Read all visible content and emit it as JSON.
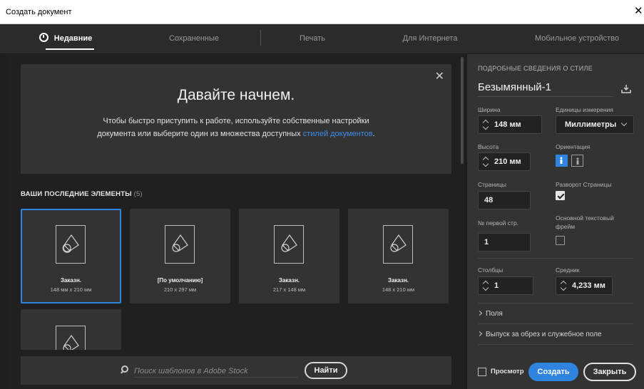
{
  "window": {
    "title": "Создать документ",
    "close_glyph": "✕"
  },
  "tabs": [
    {
      "label": "Недавние",
      "active": true
    },
    {
      "label": "Сохраненные",
      "active": false
    },
    {
      "label": "Печать",
      "active": false
    },
    {
      "label": "Для Интернета",
      "active": false
    },
    {
      "label": "Мобильное устройство",
      "active": false
    }
  ],
  "welcome": {
    "close_glyph": "✕",
    "heading": "Давайте начнем.",
    "text": "Чтобы быстро приступить к работе, используйте собственные настройки документа или выберите один из множества доступных ",
    "link": "стилей документов",
    "text_end": "."
  },
  "recent": {
    "title": "ВАШИ ПОСЛЕДНИЕ ЭЛЕМЕНТЫ",
    "count": "(5)",
    "items": [
      {
        "name": "Заказн.",
        "size": "148 мм x 210 мм",
        "selected": true
      },
      {
        "name": "[По умолчанию]",
        "size": "210 x 297 мм",
        "selected": false
      },
      {
        "name": "Заказн.",
        "size": "217 x 148 мм",
        "selected": false
      },
      {
        "name": "Заказн.",
        "size": "148 x 210 мм",
        "selected": false
      },
      {
        "name": "",
        "size": "",
        "selected": false
      }
    ]
  },
  "search": {
    "placeholder": "Поиск шаблонов в Adobe Stock",
    "button": "Найти"
  },
  "panel": {
    "title": "ПОДРОБНЫЕ СВЕДЕНИЯ О СТИЛЕ",
    "doc_name": "Безымянный-1",
    "width_label": "Ширина",
    "width_value": "148 мм",
    "units_label": "Единицы измерения",
    "units_value": "Миллиметры",
    "height_label": "Высота",
    "height_value": "210 мм",
    "orientation_label": "Ориентация",
    "pages_label": "Страницы",
    "pages_value": "48",
    "spread_label": "Разворот Страницы",
    "spread_checked": true,
    "first_page_label": "№ первой стр.",
    "first_page_value": "1",
    "text_frame_label": "Основной текстовый фрейм",
    "text_frame_checked": false,
    "columns_label": "Столбцы",
    "columns_value": "1",
    "gutter_label": "Средник",
    "gutter_value": "4,233 мм",
    "margins_label": "Поля",
    "bleed_label": "Выпуск за обрез и служебное поле"
  },
  "footer": {
    "preview_label": "Просмотр",
    "create": "Создать",
    "close": "Закрыть"
  },
  "colors": {
    "accent": "#2f84e0",
    "panel": "#333333",
    "background": "#1e1e1e"
  }
}
